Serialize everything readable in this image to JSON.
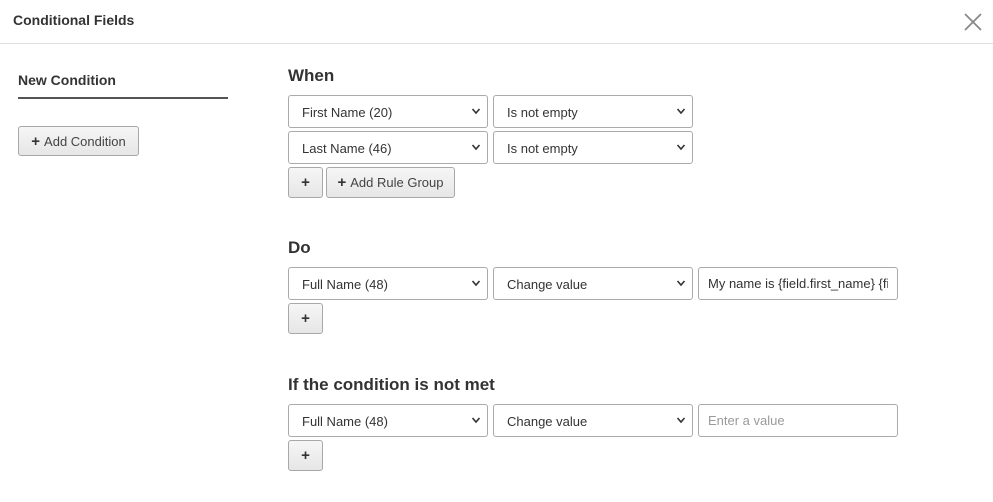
{
  "header": {
    "title": "Conditional Fields"
  },
  "sidebar": {
    "active_tab": "New Condition",
    "add_condition_label": "Add Condition"
  },
  "when": {
    "title": "When",
    "rules": [
      {
        "field": "First Name (20)",
        "operator": "Is not empty"
      },
      {
        "field": "Last Name (46)",
        "operator": "Is not empty"
      }
    ],
    "add_rule_group_label": "Add Rule Group"
  },
  "do": {
    "title": "Do",
    "actions": [
      {
        "field": "Full Name (48)",
        "action": "Change value",
        "value": "My name is {field.first_name} {field.last_name}"
      }
    ]
  },
  "otherwise": {
    "title": "If the condition is not met",
    "actions": [
      {
        "field": "Full Name (48)",
        "action": "Change value",
        "value": "",
        "placeholder": "Enter a value"
      }
    ]
  },
  "icons": {
    "close": "close-icon",
    "plus": "plus-icon",
    "chevron": "chevron-down-icon"
  }
}
